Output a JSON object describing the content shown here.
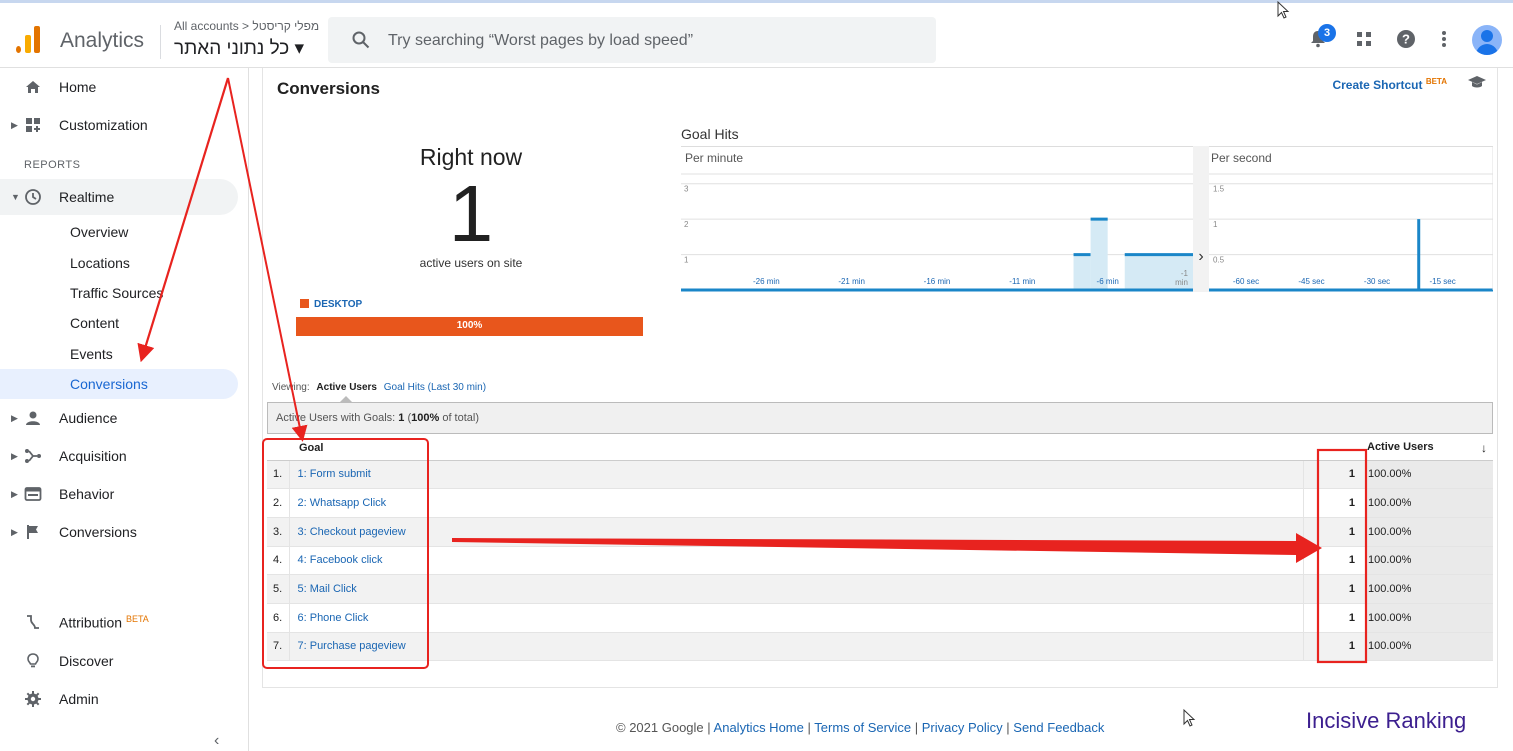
{
  "topbar": {
    "app_name": "Analytics",
    "account_path": "All accounts > מפלי קריסטל",
    "property": "כל נתוני האתר ▾",
    "search_placeholder": "Try searching “Worst pages by load speed”",
    "notification_count": "3"
  },
  "sidebar": {
    "home": "Home",
    "customization": "Customization",
    "reports_section": "REPORTS",
    "realtime": "Realtime",
    "realtime_items": [
      "Overview",
      "Locations",
      "Traffic Sources",
      "Content",
      "Events",
      "Conversions"
    ],
    "audience": "Audience",
    "acquisition": "Acquisition",
    "behavior": "Behavior",
    "conversions": "Conversions",
    "attribution": "Attribution",
    "attribution_badge": "BETA",
    "discover": "Discover",
    "admin": "Admin",
    "collapse": "‹"
  },
  "main": {
    "title": "Conversions",
    "create_shortcut": "Create Shortcut",
    "shortcut_badge": "BETA",
    "right_now_label": "Right now",
    "active_users": "1",
    "active_users_sub": "active users on site",
    "device_label": "DESKTOP",
    "device_percent_label": "100%",
    "device_share": 1.0,
    "goal_hits_title": "Goal Hits",
    "viewing_label": "Viewing:",
    "viewing_active": "Active Users",
    "viewing_other": "Goal Hits (Last 30 min)",
    "summary_prefix": "Active Users with Goals:",
    "summary_value": "1",
    "summary_pct": "100%",
    "summary_suffix": "of total",
    "table_headers": {
      "goal": "Goal",
      "active_users": "Active Users"
    },
    "goals": [
      {
        "n": "1.",
        "name": "1: Form submit",
        "value": "1",
        "pct": "100.00%"
      },
      {
        "n": "2.",
        "name": "2: Whatsapp Click",
        "value": "1",
        "pct": "100.00%"
      },
      {
        "n": "3.",
        "name": "3: Checkout pageview",
        "value": "1",
        "pct": "100.00%"
      },
      {
        "n": "4.",
        "name": "4: Facebook click",
        "value": "1",
        "pct": "100.00%"
      },
      {
        "n": "5.",
        "name": "5: Mail Click",
        "value": "1",
        "pct": "100.00%"
      },
      {
        "n": "6.",
        "name": "6: Phone Click",
        "value": "1",
        "pct": "100.00%"
      },
      {
        "n": "7.",
        "name": "7: Purchase pageview",
        "value": "1",
        "pct": "100.00%"
      }
    ]
  },
  "chart_data": [
    {
      "type": "bar",
      "title": "Per minute",
      "x_ticks": [
        "-26 min",
        "-21 min",
        "-16 min",
        "-11 min",
        "-6 min",
        "-1 min"
      ],
      "y_ticks": [
        "1",
        "2",
        "3"
      ],
      "ylim": [
        0,
        3.5
      ],
      "x_range_minutes": [
        -30,
        0
      ],
      "bars": [
        {
          "start": -7,
          "end": -6,
          "value": 1
        },
        {
          "start": -6,
          "end": -5,
          "value": 2
        },
        {
          "start": -4,
          "end": 0,
          "value": 1
        }
      ],
      "color": "#1a86c8"
    },
    {
      "type": "bar",
      "title": "Per second",
      "x_ticks": [
        "-60 sec",
        "-45 sec",
        "-30 sec",
        "-15 sec"
      ],
      "y_ticks": [
        "0.5",
        "1",
        "1.5"
      ],
      "ylim": [
        0,
        1.75
      ],
      "x_range_seconds": [
        -65,
        0
      ],
      "bars": [
        {
          "at": -17,
          "value": 1
        }
      ],
      "color": "#1a86c8"
    }
  ],
  "footer": {
    "copyright": "© 2021 Google |",
    "links": [
      "Analytics Home",
      "Terms of Service",
      "Privacy Policy",
      "Send Feedback"
    ],
    "sep": "|"
  },
  "watermark": "Incisive Ranking",
  "colors": {
    "accent": "#1a73e8",
    "device": "#e8561c",
    "link": "#1a66b3",
    "annotation": "#e8231f"
  }
}
